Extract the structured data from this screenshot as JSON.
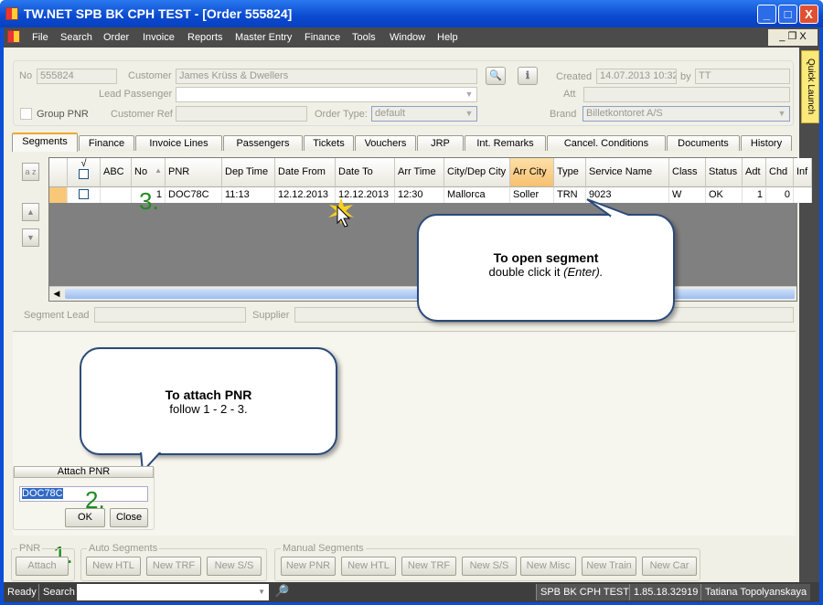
{
  "window": {
    "title": "TW.NET SPB BK CPH TEST - [Order 555824]",
    "minimize": "_",
    "maximize": "□",
    "close": "X",
    "mdi_controls": "_ ❐ X"
  },
  "menu": [
    "File",
    "Search",
    "Order",
    "Invoice",
    "Reports",
    "Master Entry",
    "Finance",
    "Tools",
    "Window",
    "Help"
  ],
  "quick_launch": "Quick Launch",
  "header": {
    "no_label": "No",
    "no_value": "555824",
    "customer_label": "Customer",
    "customer_value": "James Krüss & Dwellers",
    "lead_passenger_label": "Lead Passenger",
    "lead_passenger_value": "",
    "group_pnr_label": "Group PNR",
    "customer_ref_label": "Customer Ref",
    "customer_ref_value": "",
    "order_type_label": "Order Type:",
    "order_type_value": "default",
    "created_label": "Created",
    "created_value": "14.07.2013 10:32",
    "by_label": "by",
    "by_value": "TT",
    "att_label": "Att",
    "att_value": "",
    "brand_label": "Brand",
    "brand_value": "Billetkontoret A/S"
  },
  "tabs": [
    "Segments",
    "Finance",
    "Invoice Lines",
    "Passengers",
    "Tickets",
    "Vouchers",
    "JRP",
    "Int. Remarks",
    "Cancel. Conditions",
    "Documents",
    "History"
  ],
  "grid": {
    "check_header": "√",
    "columns": [
      "ABC",
      "No",
      "PNR",
      "Dep Time",
      "Date From",
      "Date To",
      "Arr Time",
      "City/Dep City",
      "Arr City",
      "Type",
      "Service Name",
      "Class",
      "Status",
      "Adt",
      "Chd",
      "Inf"
    ],
    "rows": [
      [
        "",
        "1",
        "DOC78C",
        "11:13",
        "12.12.2013",
        "12.12.2013",
        "12:30",
        "Mallorca",
        "Soller",
        "TRN",
        "9023",
        "W",
        "OK",
        "1",
        "0",
        ""
      ]
    ],
    "sort_button": "a z",
    "up_button": "▲",
    "down_button": "▼"
  },
  "segment_lead_label": "Segment Lead",
  "supplier_label": "Supplier",
  "callout_open": {
    "title": "To open segment",
    "text": "double click it ",
    "hint": "(Enter)."
  },
  "callout_attach": {
    "title": "To attach PNR",
    "text": "follow 1 - 2 - 3."
  },
  "steps": [
    "1.",
    "2.",
    "3."
  ],
  "attach_panel": {
    "title": "Attach PNR",
    "value": "DOC78C",
    "ok": "OK",
    "close": "Close"
  },
  "pnr_group": {
    "title": "PNR",
    "attach": "Attach"
  },
  "auto_segments": {
    "title": "Auto Segments",
    "buttons": [
      "New HTL",
      "New TRF",
      "New S/S"
    ]
  },
  "manual_segments": {
    "title": "Manual Segments",
    "buttons": [
      "New PNR",
      "New HTL",
      "New TRF",
      "New S/S",
      "New Misc",
      "New Train",
      "New Car"
    ]
  },
  "status": {
    "ready": "Ready",
    "search": "Search",
    "env": "SPB BK CPH TEST",
    "version": "1.85.18.32919",
    "user": "Tatiana Topolyanskaya"
  },
  "colors": {
    "title_bar": "#0a4ad0",
    "menu_bg": "#4b4b4b",
    "step_green": "#1f8a1f",
    "selected_column": "#f8c878"
  }
}
